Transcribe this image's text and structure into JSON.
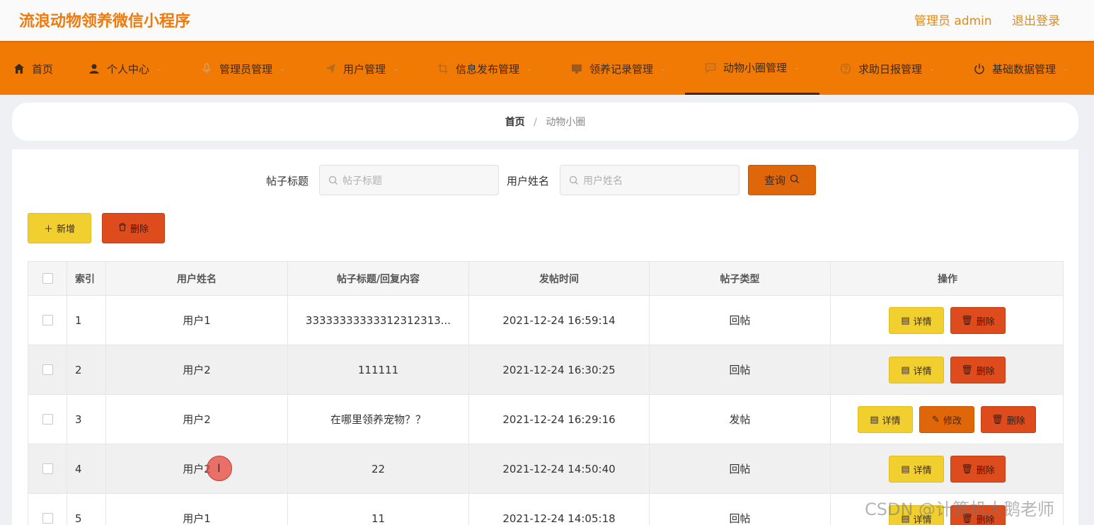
{
  "header": {
    "app_title": "流浪动物领养微信小程序",
    "admin_label": "管理员 admin",
    "logout_label": "退出登录"
  },
  "nav": {
    "items": [
      {
        "label": "首页",
        "icon": "home-icon",
        "has_dropdown": false
      },
      {
        "label": "个人中心",
        "icon": "user-icon",
        "has_dropdown": true
      },
      {
        "label": "管理员管理",
        "icon": "mic-icon",
        "has_dropdown": true
      },
      {
        "label": "用户管理",
        "icon": "send-icon",
        "has_dropdown": true
      },
      {
        "label": "信息发布管理",
        "icon": "crop-icon",
        "has_dropdown": true
      },
      {
        "label": "领养记录管理",
        "icon": "monitor-icon",
        "has_dropdown": true
      },
      {
        "label": "动物小圈管理",
        "icon": "chat-icon",
        "has_dropdown": true,
        "active": true
      },
      {
        "label": "求助日报管理",
        "icon": "help-icon",
        "has_dropdown": true
      },
      {
        "label": "基础数据管理",
        "icon": "power-icon",
        "has_dropdown": true
      }
    ],
    "color": "#f07a04"
  },
  "breadcrumb": {
    "home": "首页",
    "separator": "/",
    "current": "动物小圈"
  },
  "search": {
    "title_label": "帖子标题",
    "title_placeholder": "帖子标题",
    "user_label": "用户姓名",
    "user_placeholder": "用户姓名",
    "query_label": "查询"
  },
  "toolbar": {
    "add_label": "新增",
    "delete_label": "删除"
  },
  "table": {
    "columns": [
      "索引",
      "用户姓名",
      "帖子标题/回复内容",
      "发帖时间",
      "帖子类型",
      "操作"
    ],
    "rows": [
      {
        "index": "1",
        "user": "用户1",
        "title": "33333333333312312313...",
        "time": "2021-12-24 16:59:14",
        "type": "回帖",
        "ops": [
          "详情",
          "删除"
        ]
      },
      {
        "index": "2",
        "user": "用户2",
        "title": "111111",
        "time": "2021-12-24 16:30:25",
        "type": "回帖",
        "ops": [
          "详情",
          "删除"
        ]
      },
      {
        "index": "3",
        "user": "用户2",
        "title": "在哪里领养宠物？？",
        "time": "2021-12-24 16:29:16",
        "type": "发帖",
        "ops": [
          "详情",
          "修改",
          "删除"
        ]
      },
      {
        "index": "4",
        "user": "用户2",
        "title": "22",
        "time": "2021-12-24 14:50:40",
        "type": "回帖",
        "ops": [
          "详情",
          "删除"
        ]
      },
      {
        "index": "5",
        "user": "用户1",
        "title": "11",
        "time": "2021-12-24 14:05:18",
        "type": "回帖",
        "ops": [
          "详情",
          "删除"
        ]
      }
    ]
  },
  "watermark": "CSDN @计算机大鹅老师",
  "colors": {
    "accent": "#f07a04",
    "yellow": "#f0cf2e",
    "red": "#de4b1c",
    "orange": "#e0660a"
  }
}
